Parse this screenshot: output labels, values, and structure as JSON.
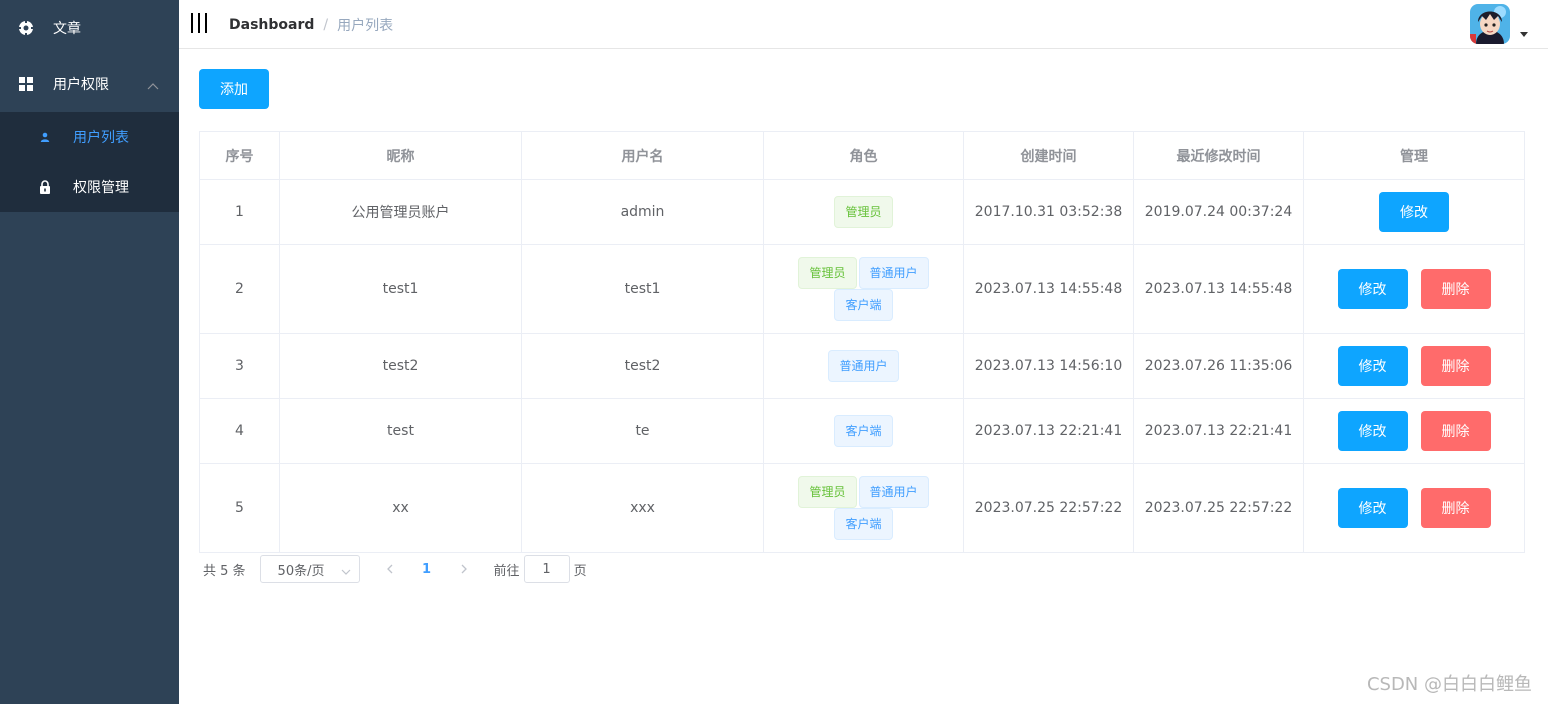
{
  "sidebar": {
    "items": [
      {
        "label": "文章",
        "icon": "compass-icon"
      },
      {
        "label": "用户权限",
        "icon": "grid-icon",
        "expanded": true,
        "children": [
          {
            "label": "用户列表",
            "icon": "user-icon",
            "active": true
          },
          {
            "label": "权限管理",
            "icon": "lock-icon",
            "active": false
          }
        ]
      }
    ]
  },
  "header": {
    "breadcrumb": {
      "home": "Dashboard",
      "separator": "/",
      "current": "用户列表"
    }
  },
  "main": {
    "add_label": "添加",
    "table": {
      "columns": [
        "序号",
        "昵称",
        "用户名",
        "角色",
        "创建时间",
        "最近修改时间",
        "管理"
      ],
      "rows": [
        {
          "index": "1",
          "nickname": "公用管理员账户",
          "username": "admin",
          "roles": [
            "管理员"
          ],
          "created": "2017.10.31 03:52:38",
          "modified": "2019.07.24 00:37:24",
          "can_delete": false
        },
        {
          "index": "2",
          "nickname": "test1",
          "username": "test1",
          "roles": [
            "管理员",
            "普通用户",
            "客户端"
          ],
          "created": "2023.07.13 14:55:48",
          "modified": "2023.07.13 14:55:48",
          "can_delete": true
        },
        {
          "index": "3",
          "nickname": "test2",
          "username": "test2",
          "roles": [
            "普通用户"
          ],
          "created": "2023.07.13 14:56:10",
          "modified": "2023.07.26 11:35:06",
          "can_delete": true
        },
        {
          "index": "4",
          "nickname": "test",
          "username": "te",
          "roles": [
            "客户端"
          ],
          "created": "2023.07.13 22:21:41",
          "modified": "2023.07.13 22:21:41",
          "can_delete": true
        },
        {
          "index": "5",
          "nickname": "xx",
          "username": "xxx",
          "roles": [
            "管理员",
            "普通用户",
            "客户端"
          ],
          "created": "2023.07.25 22:57:22",
          "modified": "2023.07.25 22:57:22",
          "can_delete": true
        }
      ],
      "edit_label": "修改",
      "delete_label": "删除"
    },
    "pagination": {
      "total_text": "共 5 条",
      "page_size": "50条/页",
      "current_page": "1",
      "goto_prefix": "前往",
      "goto_value": "1",
      "goto_suffix": "页"
    }
  },
  "watermark": "CSDN @白白白鲤鱼",
  "colors": {
    "sidebar_bg": "#2e4256",
    "submenu_bg": "#1f2d3d",
    "primary": "#0ea5ff",
    "danger": "#ff6b6b",
    "active_text": "#409eff"
  }
}
